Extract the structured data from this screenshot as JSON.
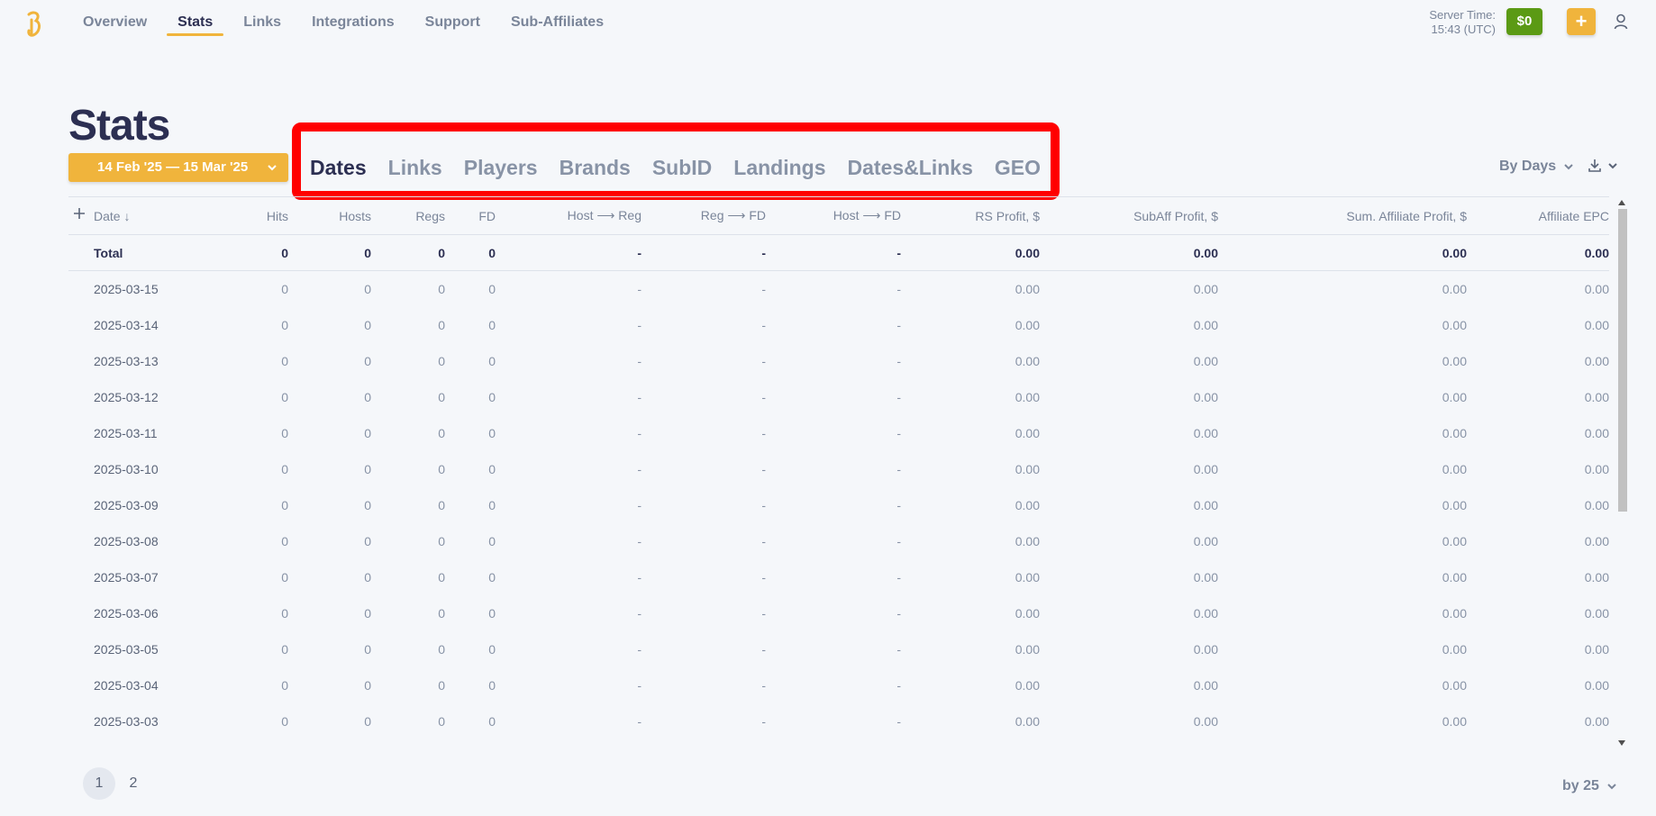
{
  "nav": {
    "items": [
      {
        "label": "Overview",
        "active": false
      },
      {
        "label": "Stats",
        "active": true
      },
      {
        "label": "Links",
        "active": false
      },
      {
        "label": "Integrations",
        "active": false
      },
      {
        "label": "Support",
        "active": false
      },
      {
        "label": "Sub-Affiliates",
        "active": false
      }
    ]
  },
  "header": {
    "server_time_label": "Server Time:",
    "server_time_value": "15:43 (UTC)",
    "balance": "$0",
    "plus": "+"
  },
  "page": {
    "title": "Stats",
    "date_range": "14 Feb '25 — 15 Mar '25",
    "group_by": "By Days",
    "per_page": "by 25"
  },
  "tabs": [
    {
      "label": "Dates",
      "active": true
    },
    {
      "label": "Links",
      "active": false
    },
    {
      "label": "Players",
      "active": false
    },
    {
      "label": "Brands",
      "active": false
    },
    {
      "label": "SubID",
      "active": false
    },
    {
      "label": "Landings",
      "active": false
    },
    {
      "label": "Dates&Links",
      "active": false
    },
    {
      "label": "GEO",
      "active": false
    }
  ],
  "table": {
    "columns": [
      "Date ↓",
      "Hits",
      "Hosts",
      "Regs",
      "FD",
      "Host ⟶ Reg",
      "Reg ⟶ FD",
      "Host ⟶ FD",
      "RS Profit, $",
      "SubAff Profit, $",
      "Sum. Affiliate Profit, $",
      "Affiliate EPC"
    ],
    "total": [
      "Total",
      "0",
      "0",
      "0",
      "0",
      "-",
      "-",
      "-",
      "0.00",
      "0.00",
      "0.00",
      "0.00"
    ],
    "rows": [
      [
        "2025-03-15",
        "0",
        "0",
        "0",
        "0",
        "-",
        "-",
        "-",
        "0.00",
        "0.00",
        "0.00",
        "0.00"
      ],
      [
        "2025-03-14",
        "0",
        "0",
        "0",
        "0",
        "-",
        "-",
        "-",
        "0.00",
        "0.00",
        "0.00",
        "0.00"
      ],
      [
        "2025-03-13",
        "0",
        "0",
        "0",
        "0",
        "-",
        "-",
        "-",
        "0.00",
        "0.00",
        "0.00",
        "0.00"
      ],
      [
        "2025-03-12",
        "0",
        "0",
        "0",
        "0",
        "-",
        "-",
        "-",
        "0.00",
        "0.00",
        "0.00",
        "0.00"
      ],
      [
        "2025-03-11",
        "0",
        "0",
        "0",
        "0",
        "-",
        "-",
        "-",
        "0.00",
        "0.00",
        "0.00",
        "0.00"
      ],
      [
        "2025-03-10",
        "0",
        "0",
        "0",
        "0",
        "-",
        "-",
        "-",
        "0.00",
        "0.00",
        "0.00",
        "0.00"
      ],
      [
        "2025-03-09",
        "0",
        "0",
        "0",
        "0",
        "-",
        "-",
        "-",
        "0.00",
        "0.00",
        "0.00",
        "0.00"
      ],
      [
        "2025-03-08",
        "0",
        "0",
        "0",
        "0",
        "-",
        "-",
        "-",
        "0.00",
        "0.00",
        "0.00",
        "0.00"
      ],
      [
        "2025-03-07",
        "0",
        "0",
        "0",
        "0",
        "-",
        "-",
        "-",
        "0.00",
        "0.00",
        "0.00",
        "0.00"
      ],
      [
        "2025-03-06",
        "0",
        "0",
        "0",
        "0",
        "-",
        "-",
        "-",
        "0.00",
        "0.00",
        "0.00",
        "0.00"
      ],
      [
        "2025-03-05",
        "0",
        "0",
        "0",
        "0",
        "-",
        "-",
        "-",
        "0.00",
        "0.00",
        "0.00",
        "0.00"
      ],
      [
        "2025-03-04",
        "0",
        "0",
        "0",
        "0",
        "-",
        "-",
        "-",
        "0.00",
        "0.00",
        "0.00",
        "0.00"
      ],
      [
        "2025-03-03",
        "0",
        "0",
        "0",
        "0",
        "-",
        "-",
        "-",
        "0.00",
        "0.00",
        "0.00",
        "0.00"
      ]
    ]
  },
  "pagination": {
    "pages": [
      {
        "label": "1",
        "active": true
      },
      {
        "label": "2",
        "active": false
      }
    ]
  },
  "colors": {
    "accent": "#f0b43c",
    "balance_green": "#5b9a14",
    "highlight_red": "#ff0000",
    "text_dark": "#2c2f52"
  }
}
